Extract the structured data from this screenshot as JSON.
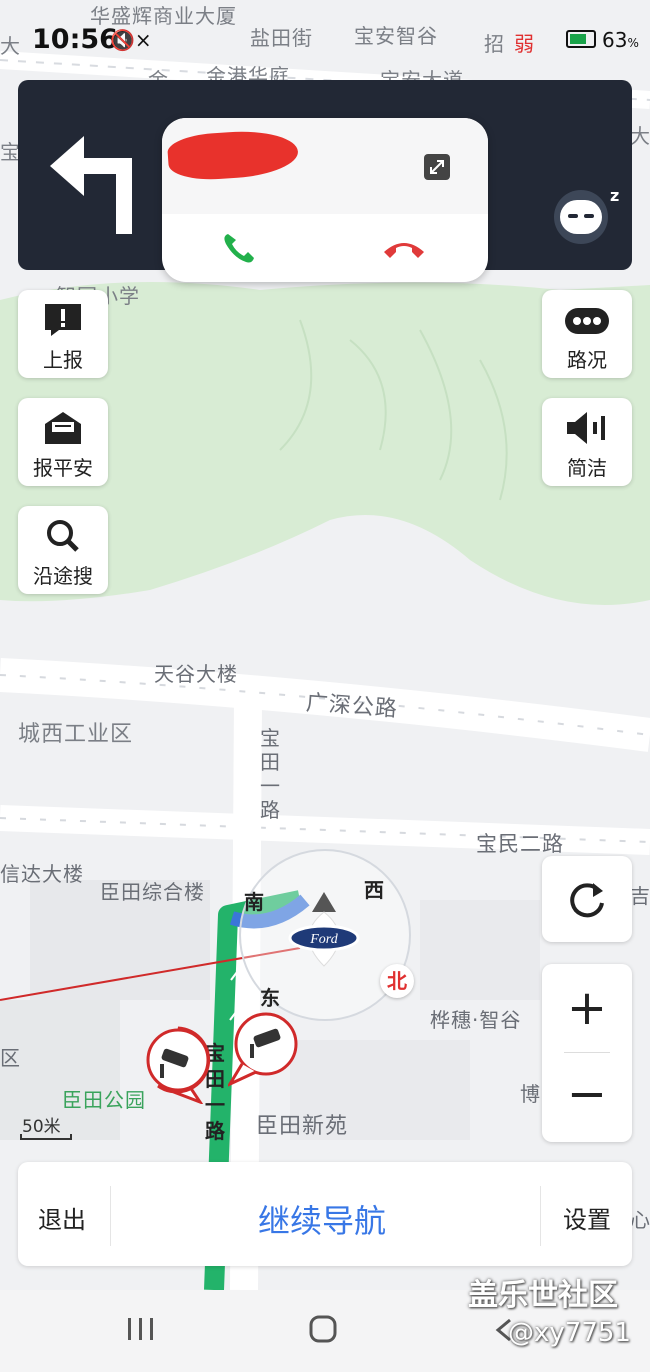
{
  "status_bar": {
    "time": "10:56",
    "mute_icon": "🔇×",
    "signal_text": "弱",
    "battery_percent": "63",
    "battery_unit": "%"
  },
  "nav_banner": {
    "turn_direction": "left-turn-arrow-icon",
    "assistant_icon": "robot-assistant-icon",
    "sleep_mark": "z"
  },
  "call_popup": {
    "caller_name": "",
    "expand_icon": "expand-icon",
    "accept_icon": "phone-accept-icon",
    "hangup_icon": "phone-hangup-icon",
    "accept_color": "#22b04b",
    "hangup_color": "#e03a3a"
  },
  "left_buttons": [
    {
      "label": "上报",
      "icon": "report-alert-icon"
    },
    {
      "label": "报平安",
      "icon": "envelope-icon"
    },
    {
      "label": "沿途搜",
      "icon": "search-icon"
    }
  ],
  "right_buttons": [
    {
      "label": "路况",
      "icon": "more-dots-icon"
    },
    {
      "label": "简洁",
      "icon": "speaker-icon"
    }
  ],
  "map_labels": {
    "l1": "华盛辉商业大厦",
    "l2": "盐田街",
    "l3": "宝安智谷",
    "l4": "招",
    "l5": "金",
    "l6": "金港华庭",
    "l7": "宝安大道",
    "l8": "智园小学",
    "l9": "天谷大楼",
    "l10": "广深公路",
    "l11": "城西工业区",
    "l12": "宝田一路",
    "l13": "宝民二路",
    "l14": "信达大楼",
    "l15": "臣田综合楼",
    "l16": "桦穗·智谷",
    "l17": "臣田公园",
    "l18": "臣田新苑",
    "l19": "博",
    "l20": "区",
    "l21": "宝田一路",
    "l22": "大",
    "l23": "宝",
    "l24": "吉",
    "l25": "心"
  },
  "compass": {
    "south": "南",
    "west": "西",
    "east": "东",
    "north": "北"
  },
  "car_brand": "Ford",
  "scale": "50米",
  "map_controls": {
    "recenter_icon": "refresh-icon",
    "zoom_in": "+",
    "zoom_out": "−"
  },
  "bottom_bar": {
    "exit_label": "退出",
    "continue_label": "继续导航",
    "settings_label": "设置"
  },
  "system_nav": {
    "recents_icon": "recents-icon",
    "home_icon": "home-icon",
    "back_icon": "back-icon"
  },
  "watermark": {
    "line1": "盖乐世社区",
    "line2": "@xy7751"
  },
  "colors": {
    "route": "#23b36a",
    "banner_bg": "#222835",
    "accent_blue": "#3877e6",
    "park_green": "#d8ecd4"
  }
}
